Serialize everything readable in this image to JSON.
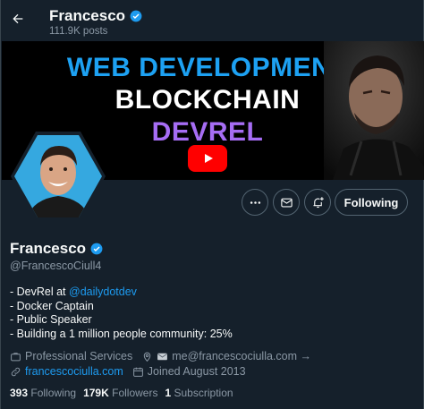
{
  "header": {
    "name": "Francesco",
    "posts": "111.9K posts"
  },
  "banner": {
    "line1": "WEB DEVELOPMENT",
    "line2": "BLOCKCHAIN",
    "line3": "DEVREL"
  },
  "actions": {
    "follow_label": "Following",
    "icons": [
      "more-icon",
      "message-icon",
      "notification-icon"
    ]
  },
  "profile": {
    "name": "Francesco",
    "handle": "@FrancescoCiull4",
    "bio": {
      "line1_prefix": "- DevRel at ",
      "line1_link": "@dailydotdev",
      "line2": "- Docker Captain",
      "line3": "- Public Speaker",
      "line4": "- Building a 1 million people community: 25%"
    },
    "category": "Professional Services",
    "email": "me@francescociulla.com →",
    "website": "francescociulla.com",
    "joined": "Joined August 2013"
  },
  "stats": {
    "following_count": "393",
    "following_label": "Following",
    "followers_count": "179K",
    "followers_label": "Followers",
    "subscriptions_count": "1",
    "subscriptions_label": "Subscription"
  },
  "colors": {
    "background": "#15202b",
    "accent": "#1d9bf0",
    "muted": "#8b98a5",
    "youtube": "#ff0000",
    "banner_blue": "#1da1f2",
    "banner_purple": "#a66df4"
  }
}
